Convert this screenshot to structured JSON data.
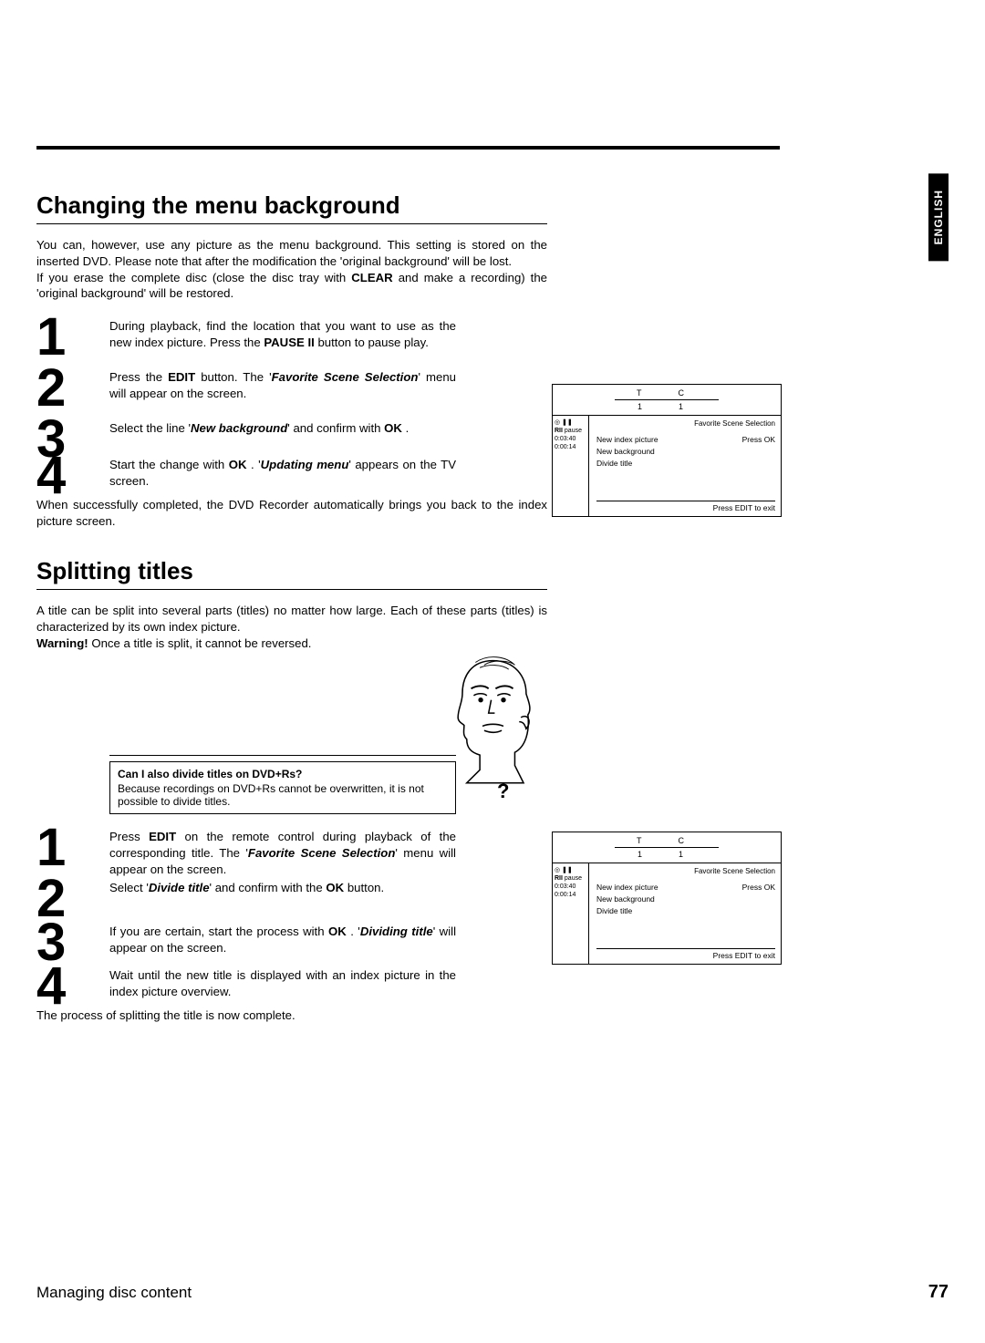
{
  "lang_tab": "ENGLISH",
  "sec1": {
    "title": "Changing the menu background",
    "intro_prefix": "You can, however, use any picture as the menu background. This setting is stored on the inserted DVD. Please note that after the modification the 'original background' will be lost.\nIf you erase the complete disc (close the disc tray with ",
    "intro_key": "CLEAR",
    "intro_suffix": " and make a recording) the 'original background' will be restored.",
    "step1_a": "During playback, find the location that you want to use as the new index picture. Press the ",
    "step1_key": "PAUSE II",
    "step1_b": " button to pause play.",
    "step2_a": "Press the ",
    "step2_key": "EDIT",
    "step2_b": " button. The '",
    "step2_menu": "Favorite Scene Selection",
    "step2_c": "' menu will appear on the screen.",
    "step3_a": "Select the line '",
    "step3_menu": "New background",
    "step3_b": "' and confirm with ",
    "step3_key": "OK",
    "step3_c": " .",
    "step4_a": "Start the change with ",
    "step4_key": "OK",
    "step4_b": " . '",
    "step4_menu": "Updating menu",
    "step4_c": "' appears on the TV screen.",
    "after": "When successfully completed, the DVD Recorder automatically brings you back to the index picture screen."
  },
  "sec2": {
    "title": "Splitting titles",
    "intro_a": "A title can be split into several parts (titles) no matter how large. Each of these parts (titles) is characterized by its own index picture.",
    "intro_warn_label": "Warning!",
    "intro_warn": " Once a title is split, it cannot be reversed.",
    "tip_title": "Can I also divide titles on DVD+Rs?",
    "tip_body": "Because recordings on DVD+Rs cannot be overwritten, it is not possible to divide titles.",
    "qmark": "?",
    "step1_a": "Press ",
    "step1_key": "EDIT",
    "step1_b": " on the remote control during playback of the corresponding title. The '",
    "step1_menu": "Favorite Scene Selection",
    "step1_c": "' menu will appear on the screen.",
    "step2_a": "Select '",
    "step2_menu": "Divide title",
    "step2_b": "' and confirm with the ",
    "step2_key": "OK",
    "step2_c": " button.",
    "step3_a": "If you are certain, start the process with ",
    "step3_key": "OK",
    "step3_b": " . '",
    "step3_menu": "Dividing title",
    "step3_c": "' will appear on the screen.",
    "step4": "Wait until the new title is displayed with an index picture in the index picture overview.",
    "after": "The process of splitting the title is now complete."
  },
  "osd": {
    "hdr_t": "T",
    "hdr_c": "C",
    "hdr_1a": "1",
    "hdr_1b": "1",
    "left_pause": "pause",
    "left_rii": "RII",
    "left_t1": "0:03:40",
    "left_t2": "0:00:14",
    "title_label": "Favorite Scene Selection",
    "row_new_index": "New index picture",
    "row_press_ok": "Press OK",
    "row_new_bg": "New background",
    "row_divide": "Divide title",
    "footer": "Press EDIT to exit"
  },
  "footer": {
    "title": "Managing disc content",
    "page": "77"
  }
}
